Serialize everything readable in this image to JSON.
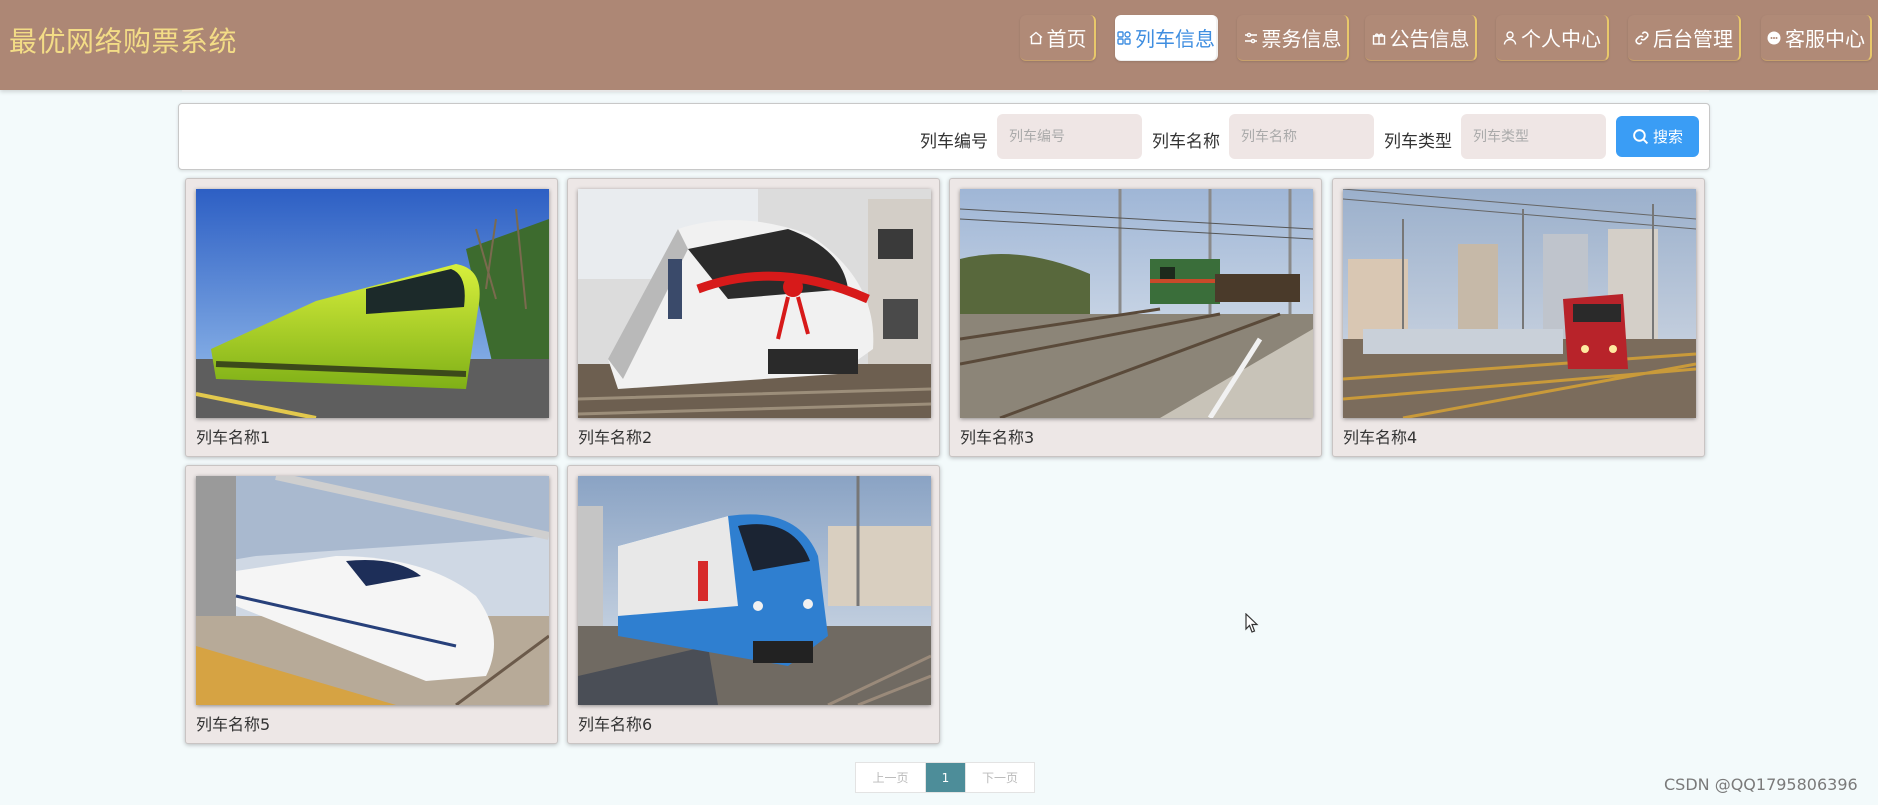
{
  "brand": "最优网络购票系统",
  "nav": [
    {
      "label": "首页",
      "icon": "home-icon"
    },
    {
      "label": "列车信息",
      "icon": "grid-icon",
      "active": true
    },
    {
      "label": "票务信息",
      "icon": "sliders-icon"
    },
    {
      "label": "公告信息",
      "icon": "gift-icon"
    },
    {
      "label": "个人中心",
      "icon": "user-icon"
    },
    {
      "label": "后台管理",
      "icon": "link-icon"
    },
    {
      "label": "客服中心",
      "icon": "chat-icon"
    }
  ],
  "search": {
    "fields": [
      {
        "label": "列车编号",
        "placeholder": "列车编号",
        "value": ""
      },
      {
        "label": "列车名称",
        "placeholder": "列车名称",
        "value": ""
      },
      {
        "label": "列车类型",
        "placeholder": "列车类型",
        "value": ""
      }
    ],
    "button_label": "搜索",
    "button_icon": "search-icon"
  },
  "trains": [
    {
      "name": "列车名称1",
      "photo": "green-tram-photo"
    },
    {
      "name": "列车名称2",
      "photo": "white-metro-ribbon-photo"
    },
    {
      "name": "列车名称3",
      "photo": "green-freight-locomotive-photo"
    },
    {
      "name": "列车名称4",
      "photo": "red-locomotive-city-photo"
    },
    {
      "name": "列车名称5",
      "photo": "white-highspeed-train-photo"
    },
    {
      "name": "列车名称6",
      "photo": "blue-commuter-train-photo"
    }
  ],
  "pagination": {
    "prev_label": "上一页",
    "current_page": "1",
    "next_label": "下一页"
  },
  "watermark": "CSDN @QQ1795806396",
  "colors": {
    "header_bg": "#ad8775",
    "brand_text": "#f3dc86",
    "active_nav_text": "#3f8ee0",
    "search_button": "#3a9df5",
    "active_page": "#4d8d99",
    "page_bg": "#f3fafb"
  }
}
